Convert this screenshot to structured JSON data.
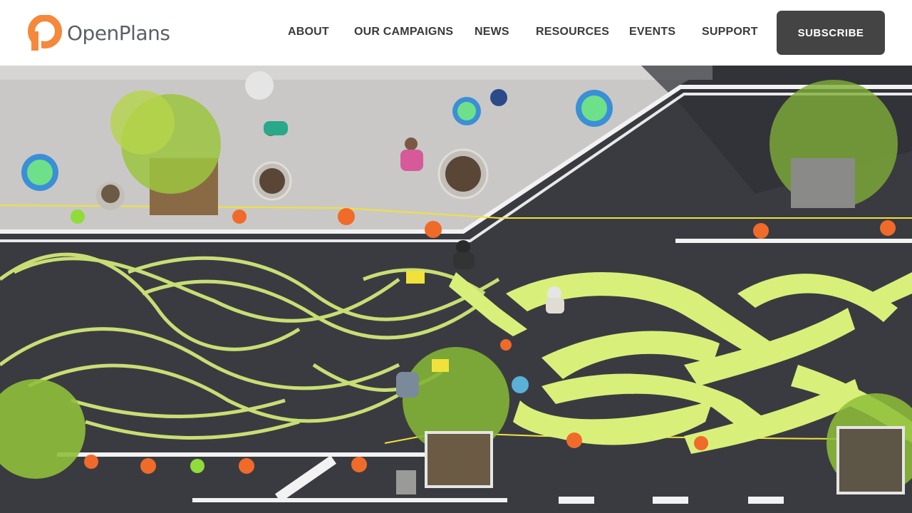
{
  "brand": {
    "name": "OpenPlans",
    "accent_color": "#f5883a",
    "text_color": "#5b5f66"
  },
  "nav": {
    "items": [
      {
        "label": "ABOUT"
      },
      {
        "label": "OUR CAMPAIGNS"
      },
      {
        "label": "NEWS"
      },
      {
        "label": "RESOURCES"
      },
      {
        "label": "EVENTS"
      },
      {
        "label": "SUPPORT"
      }
    ],
    "subscribe_label": "SUBSCRIBE"
  },
  "hero": {
    "image_subject": "aerial photo of a street plaza with a yellow-green braided mural painted on asphalt",
    "colors": {
      "asphalt": "#3a3b41",
      "plaza": "#c9c8c6",
      "mural": "#d8f07a",
      "cone": "#f06a2a",
      "tree": "#8fbf3a"
    }
  }
}
